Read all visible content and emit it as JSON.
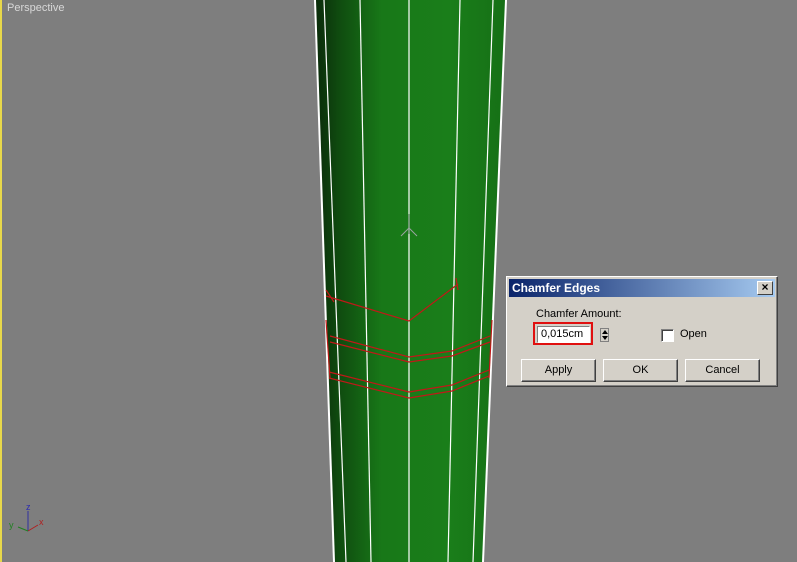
{
  "viewport": {
    "label": "Perspective"
  },
  "axis_gizmo": {
    "z": "z",
    "y": "y",
    "x": "x"
  },
  "dialog": {
    "title": "Chamfer Edges",
    "close_glyph": "×",
    "chamfer_amount_label": "Chamfer Amount:",
    "chamfer_amount_value": "0,015cm",
    "open_label": "Open",
    "open_checked": false,
    "buttons": {
      "apply": "Apply",
      "ok": "OK",
      "cancel": "Cancel"
    }
  },
  "colors": {
    "viewport_bg": "#7e7e7e",
    "model_green": "#1a7a1a",
    "selection_red": "#c01818",
    "titlebar": "#0a246a"
  }
}
